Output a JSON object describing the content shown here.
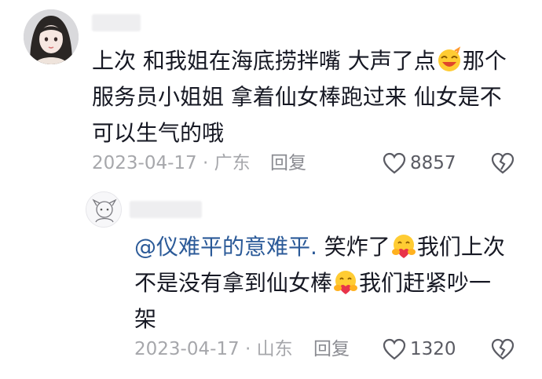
{
  "comment1": {
    "lines": [
      [
        "上次 和我姐在海底捞拌嘴 大声了点",
        "那个"
      ],
      "服务员小姐姐 拿着仙女棒跑过来 仙女是不",
      "可以生气的哦"
    ],
    "emoji": "laughing-face-emoji",
    "date": "2023-04-17",
    "location": "广东",
    "reply_label": "回复",
    "like_count": "8857"
  },
  "comment2": {
    "mention": "@仪难平的意难平.",
    "line1_after": " 笑炸了",
    "line1_end": "我们上次",
    "line2_start": "不是没有拿到仙女棒",
    "line2_end": "我们赶紧吵一",
    "line3": "架",
    "emoji": "hugging-face-emoji",
    "date": "2023-04-17",
    "location": "山东",
    "reply_label": "回复",
    "like_count": "1320"
  },
  "colors": {
    "text": "#161823",
    "meta": "#a6a7ab",
    "mention": "#2b5a98"
  }
}
